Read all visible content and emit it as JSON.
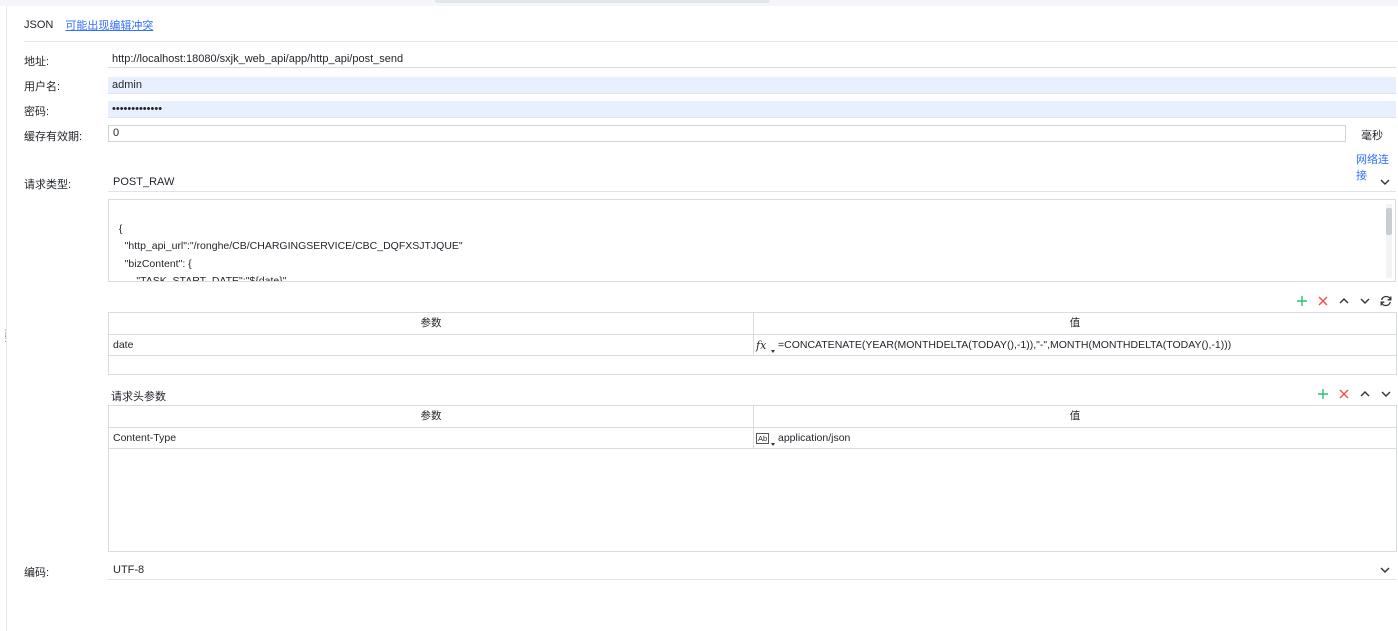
{
  "tabs": {
    "json": "JSON",
    "conflict_link": "可能出现编辑冲突"
  },
  "form": {
    "address": {
      "label": "地址:",
      "value": "http://localhost:18080/sxjk_web_api/app/http_api/post_send"
    },
    "username": {
      "label": "用户名:",
      "value": "admin"
    },
    "password": {
      "label": "密码:",
      "value": "•••••••••••••"
    },
    "cache": {
      "label": "缓存有效期:",
      "value": "0",
      "unit": "毫秒"
    },
    "network_link": "网络连接",
    "request_type": {
      "label": "请求类型:",
      "value": "POST_RAW"
    },
    "encoding": {
      "label": "编码:",
      "value": "UTF-8"
    }
  },
  "body_code": "{\n    \"http_api_url\":\"/ronghe/CB/CHARGINGSERVICE/CBC_DQFXSJTJQUE\"\n    \"bizContent\": {\n        \"TASK_START_DATE\":\"${date}\"\n    }",
  "params_table": {
    "headers": {
      "key": "参数",
      "value": "值"
    },
    "rows": [
      {
        "key": "date",
        "type": "fx",
        "value": "=CONCATENATE(YEAR(MONTHDELTA(TODAY(),-1)),\"-\",MONTH(MONTHDELTA(TODAY(),-1)))"
      }
    ]
  },
  "headers_section": {
    "title": "请求头参数",
    "headers": {
      "key": "参数",
      "value": "值"
    },
    "rows": [
      {
        "key": "Content-Type",
        "type": "Ab",
        "value": "application/json"
      }
    ]
  },
  "colors": {
    "accent": "#3370ff",
    "add": "#2fbf71",
    "delete": "#f54a45",
    "filled": "#e8f0fe"
  }
}
